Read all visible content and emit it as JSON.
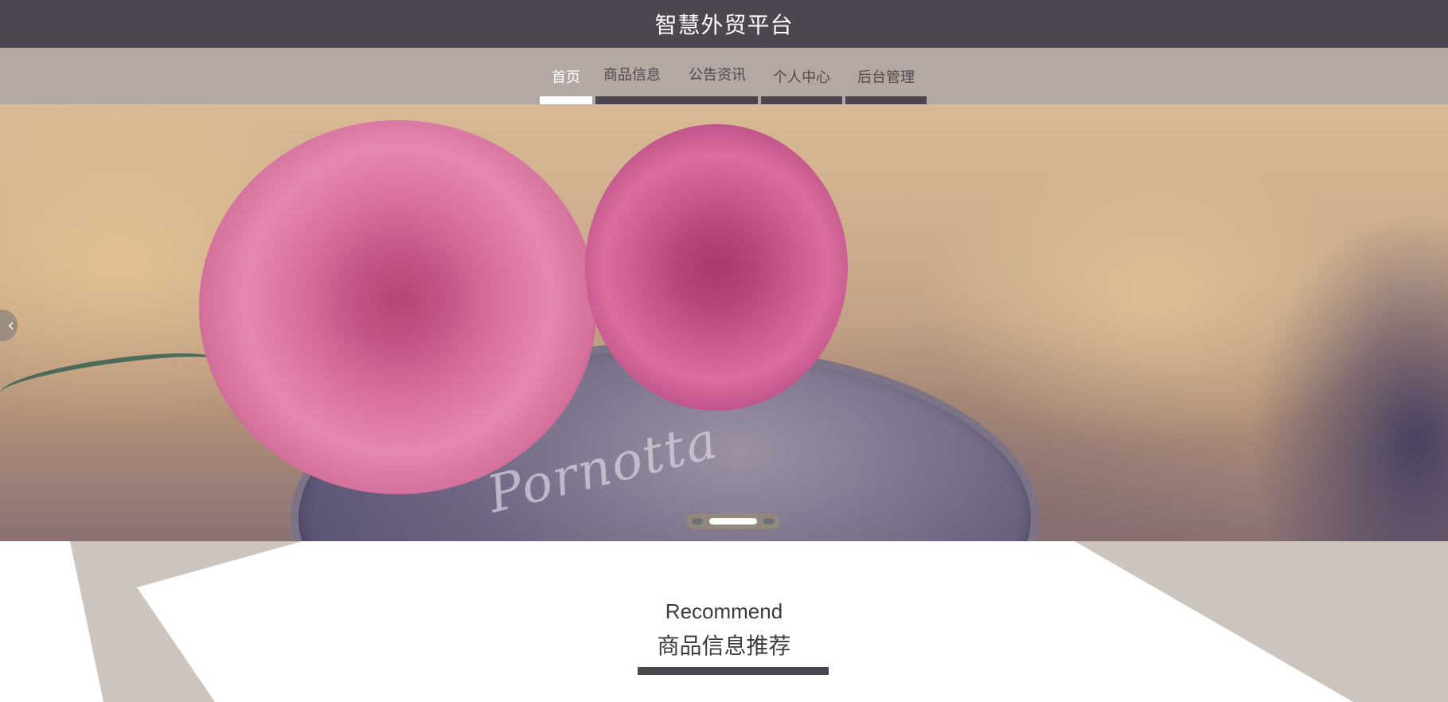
{
  "header": {
    "title": "智慧外贸平台"
  },
  "nav": {
    "items": [
      {
        "label": "首页",
        "active": true
      },
      {
        "label": "商品信息",
        "active": false
      },
      {
        "label": "公告资讯",
        "active": false
      },
      {
        "label": "个人中心",
        "active": false
      },
      {
        "label": "后台管理",
        "active": false
      }
    ]
  },
  "banner": {
    "image_text": "Pornotta",
    "arrow_icon": "chevron-left-icon",
    "slide_count": 3,
    "active_slide": 2
  },
  "recommend": {
    "title_en": "Recommend",
    "title_cn": "商品信息推荐"
  },
  "colors": {
    "header_bg": "#4d4650",
    "nav_bg": "#b4a8a3",
    "accent_beige": "#ccc4bd"
  }
}
